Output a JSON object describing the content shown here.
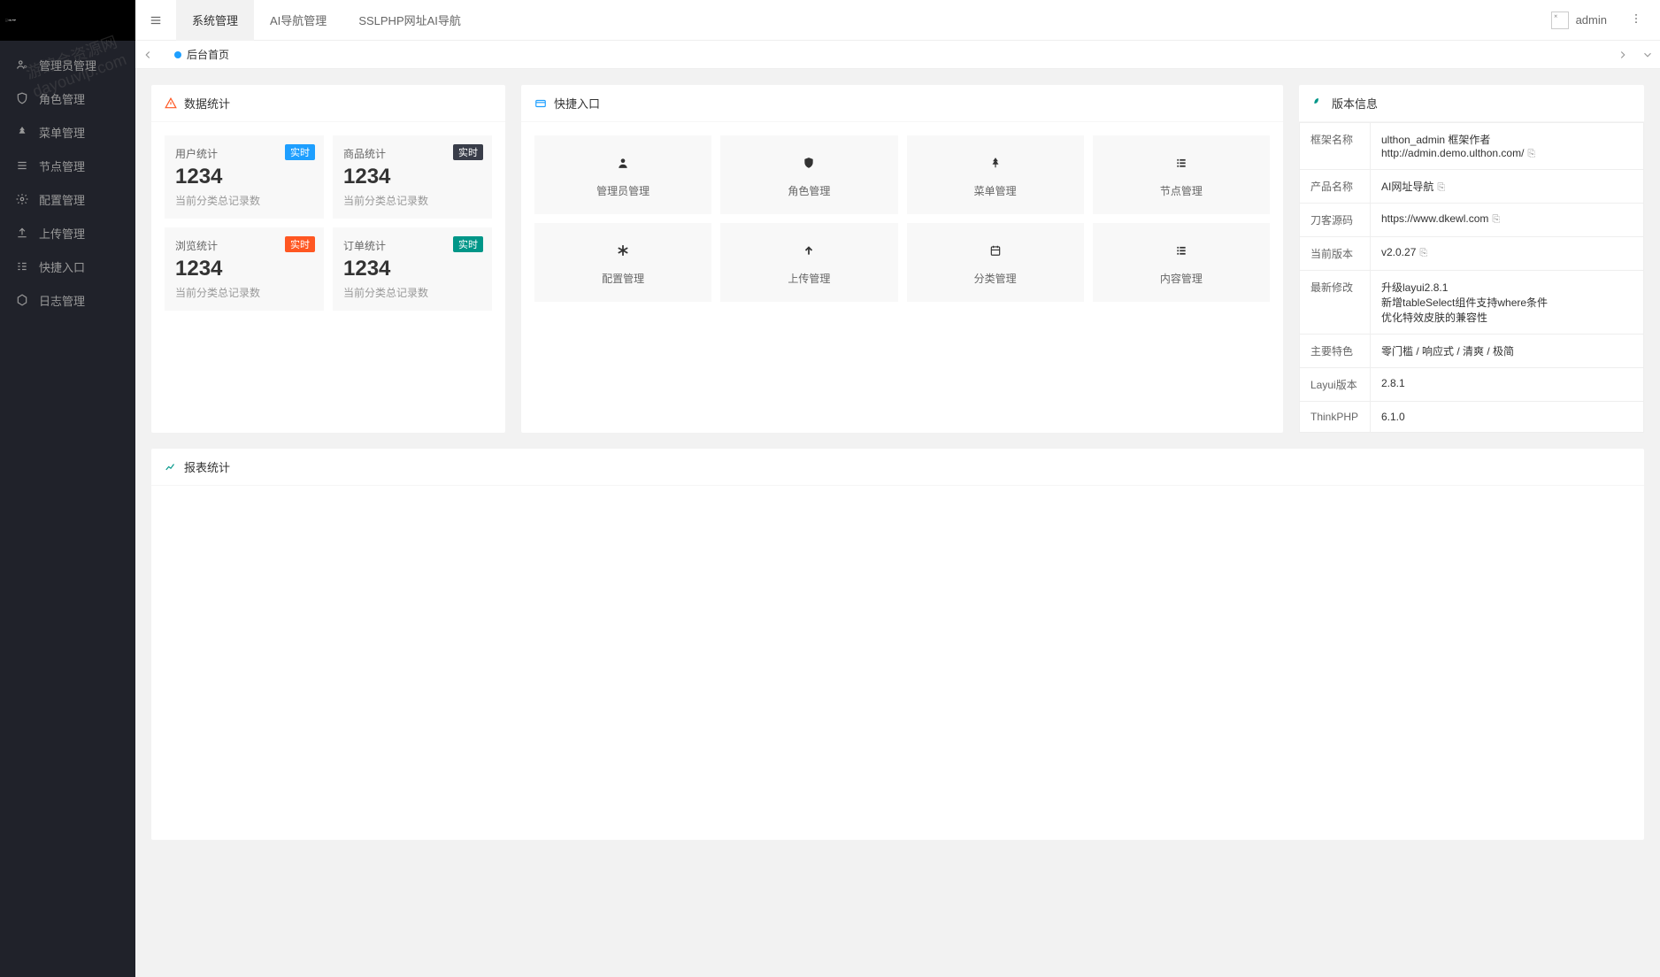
{
  "logo": "SSLPHP",
  "sidebar": {
    "items": [
      {
        "icon": "user-cog",
        "label": "管理员管理"
      },
      {
        "icon": "shield",
        "label": "角色管理"
      },
      {
        "icon": "tree",
        "label": "菜单管理"
      },
      {
        "icon": "list",
        "label": "节点管理"
      },
      {
        "icon": "cog",
        "label": "配置管理"
      },
      {
        "icon": "upload",
        "label": "上传管理"
      },
      {
        "icon": "grid",
        "label": "快捷入口"
      },
      {
        "icon": "hexagon",
        "label": "日志管理"
      }
    ]
  },
  "watermark": "游综合资源网\ndayouvip.com",
  "header": {
    "nav": [
      {
        "label": "系统管理",
        "active": true
      },
      {
        "label": "AI导航管理",
        "active": false
      },
      {
        "label": "SSLPHP网址AI导航",
        "active": false
      }
    ],
    "user": "admin"
  },
  "tabs": {
    "active": "后台首页"
  },
  "stats": {
    "title": "数据统计",
    "items": [
      {
        "title": "用户统计",
        "value": "1234",
        "desc": "当前分类总记录数",
        "badge": "实时",
        "badgeColor": "blue"
      },
      {
        "title": "商品统计",
        "value": "1234",
        "desc": "当前分类总记录数",
        "badge": "实时",
        "badgeColor": "black"
      },
      {
        "title": "浏览统计",
        "value": "1234",
        "desc": "当前分类总记录数",
        "badge": "实时",
        "badgeColor": "orange"
      },
      {
        "title": "订单统计",
        "value": "1234",
        "desc": "当前分类总记录数",
        "badge": "实时",
        "badgeColor": "green"
      }
    ]
  },
  "shortcuts": {
    "title": "快捷入口",
    "items": [
      {
        "icon": "👤",
        "label": "管理员管理"
      },
      {
        "icon": "🛡",
        "label": "角色管理"
      },
      {
        "icon": "🎄",
        "label": "菜单管理"
      },
      {
        "icon": "≡",
        "label": "节点管理"
      },
      {
        "icon": "✱",
        "label": "配置管理"
      },
      {
        "icon": "↑",
        "label": "上传管理"
      },
      {
        "icon": "📅",
        "label": "分类管理"
      },
      {
        "icon": "≡",
        "label": "内容管理"
      }
    ]
  },
  "version": {
    "title": "版本信息",
    "rows": [
      {
        "label": "框架名称",
        "value": "ulthon_admin 框架作者http://admin.demo.ulthon.com/",
        "copy": true
      },
      {
        "label": "产品名称",
        "value": "AI网址导航",
        "copy": true
      },
      {
        "label": "刀客源码",
        "value": "https://www.dkewl.com",
        "copy": true
      },
      {
        "label": "当前版本",
        "value": "v2.0.27",
        "copy": true
      },
      {
        "label": "最新修改",
        "value": "升级layui2.8.1\n新增tableSelect组件支持where条件\n优化特效皮肤的兼容性",
        "copy": false
      },
      {
        "label": "主要特色",
        "value": "零门槛 / 响应式 / 清爽 / 极简",
        "copy": false
      },
      {
        "label": "Layui版本",
        "value": "2.8.1",
        "copy": false
      },
      {
        "label": "ThinkPHP",
        "value": "6.1.0",
        "copy": false
      }
    ]
  },
  "report": {
    "title": "报表统计"
  }
}
